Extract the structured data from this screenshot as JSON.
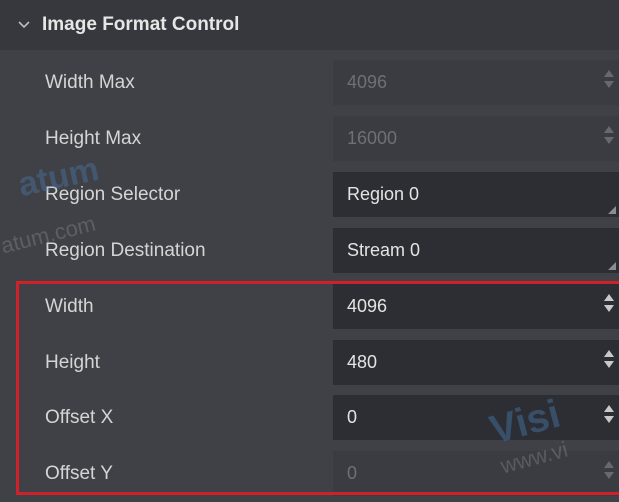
{
  "section": {
    "title": "Image Format Control",
    "icon": "chevron-down-icon"
  },
  "rows": [
    {
      "label": "Width Max",
      "value": "4096",
      "control": "spinbox",
      "enabled": false
    },
    {
      "label": "Height Max",
      "value": "16000",
      "control": "spinbox",
      "enabled": false
    },
    {
      "label": "Region Selector",
      "value": "Region 0",
      "control": "dropdown",
      "enabled": true
    },
    {
      "label": "Region Destination",
      "value": "Stream 0",
      "control": "dropdown",
      "enabled": true
    },
    {
      "label": "Width",
      "value": "4096",
      "control": "spinbox",
      "enabled": true
    },
    {
      "label": "Height",
      "value": "480",
      "control": "spinbox",
      "enabled": true
    },
    {
      "label": "Offset X",
      "value": "0",
      "control": "spinbox",
      "enabled": true
    },
    {
      "label": "Offset Y",
      "value": "0",
      "control": "spinbox",
      "enabled": false
    }
  ],
  "watermark": {
    "text1": "atum",
    "text2": "atum.com",
    "text3": "Visi",
    "text4": "www.vi"
  },
  "colors": {
    "highlight": "#d0202a",
    "background": "#3f4147",
    "field": "#34363b"
  }
}
